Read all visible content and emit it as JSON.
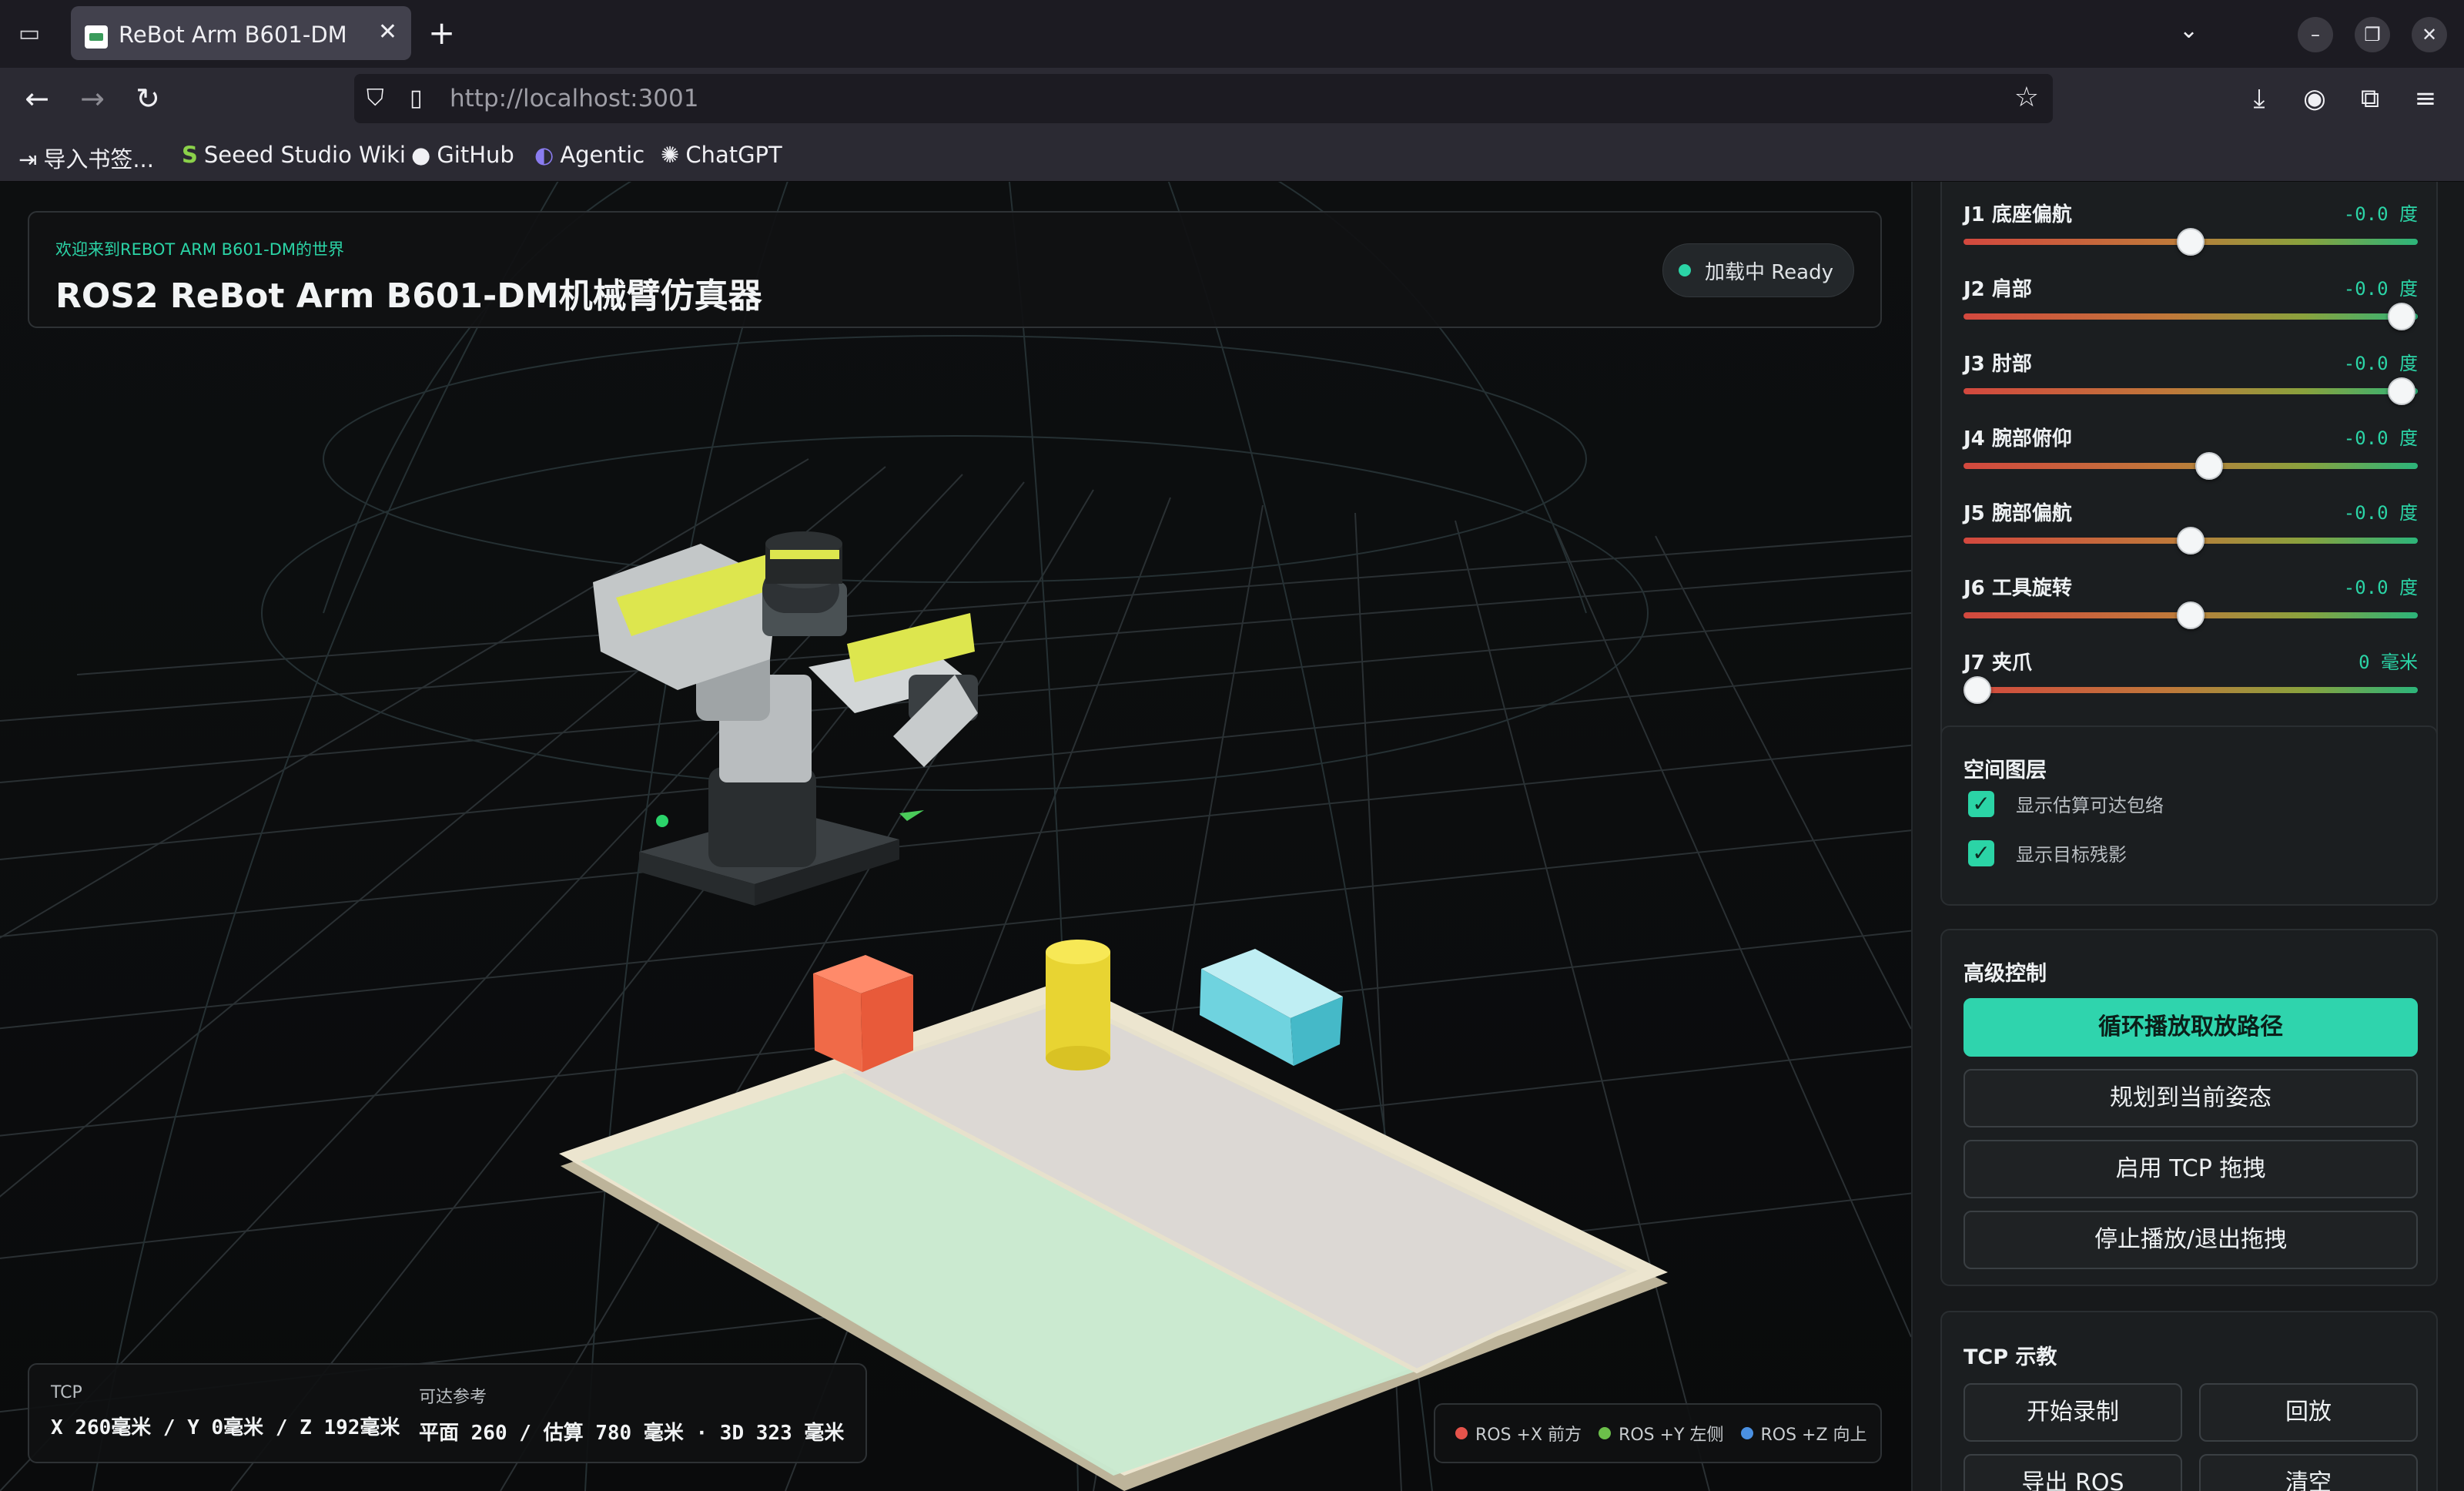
{
  "browser": {
    "tab_title": "ReBot Arm B601-DM",
    "tab_close": "✕",
    "new_tab": "+",
    "url_host": "http://localhost",
    "url_port": ":3001",
    "bookmarks": [
      {
        "icon": "import-icon",
        "label": "导入书签..."
      },
      {
        "icon": "seeed-icon",
        "label": "Seeed Studio Wiki"
      },
      {
        "icon": "github-icon",
        "label": "GitHub"
      },
      {
        "icon": "agentic-icon",
        "label": "Agentic"
      },
      {
        "icon": "chatgpt-icon",
        "label": "ChatGPT"
      }
    ]
  },
  "header": {
    "subtitle": "欢迎来到REBOT ARM B601-DM的世界",
    "title": "ROS2 ReBot Arm B601-DM机械臂仿真器",
    "status": "加载中 Ready",
    "status_color": "#2bd4a6"
  },
  "tcp": {
    "label": "TCP",
    "value": "X 260毫米 / Y 0毫米 / Z 192毫米",
    "reach_label": "可达参考",
    "reach_value": "平面 260 / 估算 780 毫米 · 3D 323 毫米"
  },
  "axes": [
    {
      "label": "ROS +X 前方",
      "color": "#e5534b"
    },
    {
      "label": "ROS +Y 左侧",
      "color": "#6cc04a"
    },
    {
      "label": "ROS +Z 向上",
      "color": "#4a90e2"
    }
  ],
  "joints": [
    {
      "label": "J1 底座偏航",
      "value": "-0.0 度",
      "fraction": 0.5
    },
    {
      "label": "J2 肩部",
      "value": "-0.0 度",
      "fraction": 0.965
    },
    {
      "label": "J3 肘部",
      "value": "-0.0 度",
      "fraction": 0.965
    },
    {
      "label": "J4 腕部俯仰",
      "value": "-0.0 度",
      "fraction": 0.54
    },
    {
      "label": "J5 腕部偏航",
      "value": "-0.0 度",
      "fraction": 0.5
    },
    {
      "label": "J6 工具旋转",
      "value": "-0.0 度",
      "fraction": 0.5
    },
    {
      "label": "J7 夹爪",
      "value": "0 毫米",
      "fraction": 0.03
    }
  ],
  "layers": {
    "title": "空间图层",
    "items": [
      {
        "label": "显示估算可达包络",
        "checked": true
      },
      {
        "label": "显示目标残影",
        "checked": true
      }
    ]
  },
  "advanced": {
    "title": "高级控制",
    "primary": "循环播放取放路径",
    "plan": "规划到当前姿态",
    "tcp_drag": "启用 TCP 拖拽",
    "stop": "停止播放/退出拖拽"
  },
  "teach": {
    "title": "TCP 示教",
    "record": "开始录制",
    "replay": "回放",
    "export": "导出 ROS",
    "clear": "清空"
  }
}
